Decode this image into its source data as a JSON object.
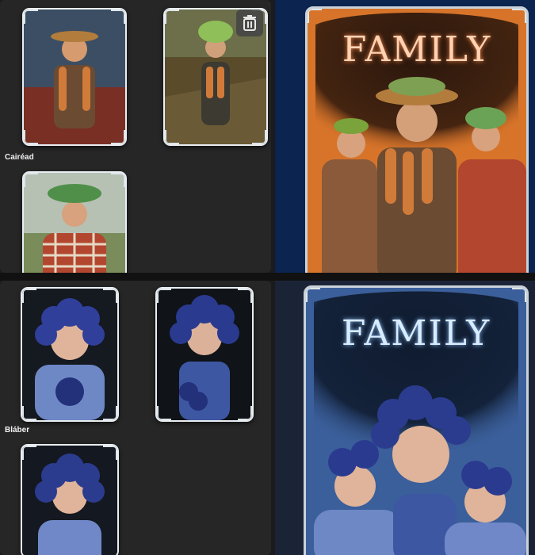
{
  "groups": [
    {
      "label": "Cairéad",
      "cover_title": "FAMILY",
      "theme": {
        "cover_bg": "#d7742a",
        "cover_dark": "#2a160c",
        "title_color": "#ffd3b4",
        "frame": "#c9d2d8"
      },
      "cards": [
        {
          "name": "farmer-man",
          "palette": [
            "#2d3946",
            "#7a3e24",
            "#c9743a"
          ]
        },
        {
          "name": "farmer-woman-field",
          "palette": [
            "#56633a",
            "#6a4b2d",
            "#b9d46a"
          ]
        },
        {
          "name": "boy-carrot-hair",
          "palette": [
            "#b8c2b8",
            "#a43b2a",
            "#6fa35e"
          ]
        }
      ]
    },
    {
      "label": "Bláber",
      "cover_title": "FAMILY",
      "theme": {
        "cover_bg": "#3b5f9b",
        "cover_dark": "#0f1b2f",
        "title_color": "#d9ecff",
        "frame": "#c9d2d8"
      },
      "cards": [
        {
          "name": "blueberry-child-1",
          "palette": [
            "#1b1d25",
            "#2f3f9a",
            "#6e88c6"
          ]
        },
        {
          "name": "blueberry-child-2",
          "palette": [
            "#13161a",
            "#2a3a8f",
            "#6a7fb8"
          ]
        },
        {
          "name": "blueberry-child-3",
          "palette": [
            "#1a1f26",
            "#2b3c8f",
            "#7088c7"
          ]
        }
      ]
    }
  ],
  "icons": {
    "delete": "trash-icon"
  }
}
